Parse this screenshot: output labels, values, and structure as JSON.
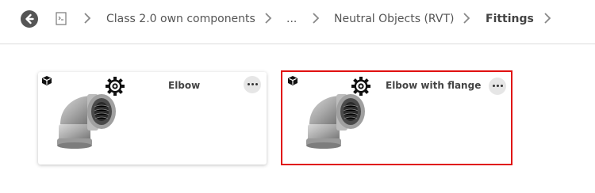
{
  "breadcrumb": {
    "items": [
      {
        "label": "Class 2.0 own components"
      },
      {
        "label": "..."
      },
      {
        "label": "Neutral Objects (RVT)"
      },
      {
        "label": "Fittings"
      }
    ]
  },
  "icons": {
    "back": "back-arrow-icon",
    "document": "document-icon",
    "separator": "chevron-right-icon",
    "object_type": "cube-icon",
    "parametric": "gear-icon",
    "more": "more-options-icon"
  },
  "cards": [
    {
      "title": "Elbow",
      "selected": false
    },
    {
      "title": "Elbow with flange",
      "selected": true
    }
  ],
  "colors": {
    "selection_border": "#e01010",
    "back_button": "#555555",
    "more_button_bg": "#e6e6e6"
  }
}
